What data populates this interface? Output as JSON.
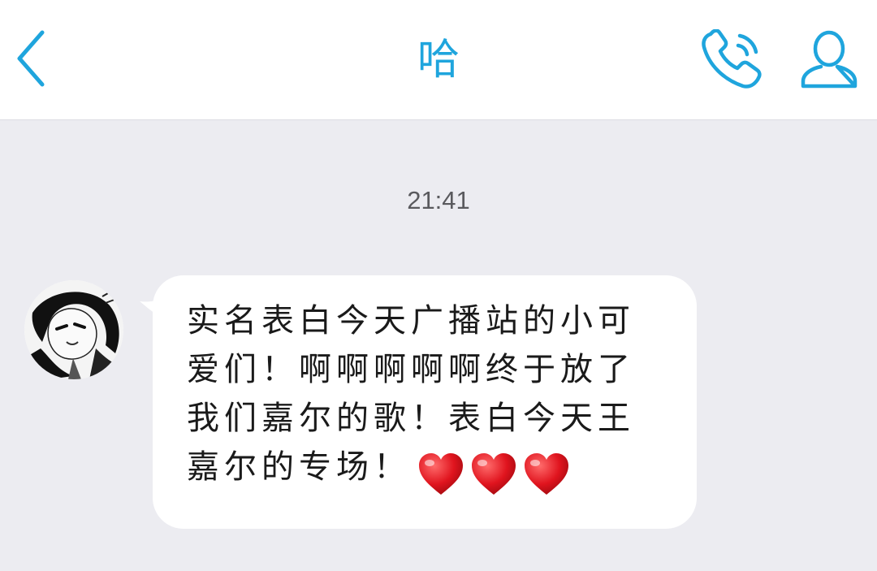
{
  "header": {
    "title": "哈",
    "accent_color": "#1fa5dd",
    "back_icon": "chevron-left-icon",
    "call_icon": "phone-icon",
    "profile_icon": "user-icon"
  },
  "chat": {
    "background_color": "#ececf1",
    "timestamp": "21:41",
    "messages": [
      {
        "direction": "incoming",
        "avatar": "anime-girl-avatar",
        "text": "实名表白今天广播站的小可爱们！啊啊啊啊啊终于放了我们嘉尔的歌！表白今天王嘉尔的专场！",
        "emoji": [
          "❤️",
          "❤️",
          "❤️"
        ]
      }
    ]
  }
}
